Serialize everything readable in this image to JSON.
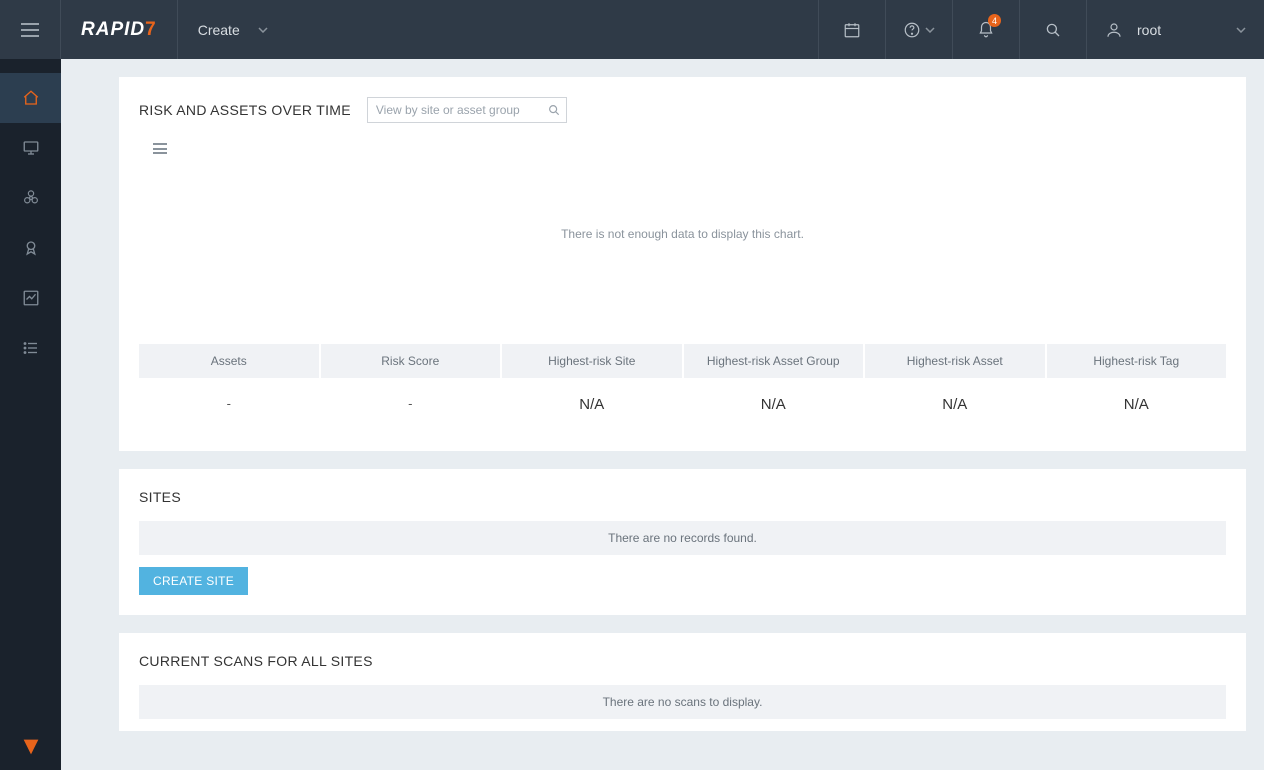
{
  "header": {
    "brand_prefix": "RAPID",
    "brand_suffix": "7",
    "create_label": "Create",
    "user_name": "root",
    "notifications_count": "4"
  },
  "sidebar": {
    "items": [
      {
        "name": "home"
      },
      {
        "name": "assets"
      },
      {
        "name": "vulnerabilities"
      },
      {
        "name": "policies"
      },
      {
        "name": "reports"
      },
      {
        "name": "automation"
      }
    ]
  },
  "risk_panel": {
    "title": "RISK AND ASSETS OVER TIME",
    "filter_placeholder": "View by site or asset group",
    "empty_message": "There is not enough data to display this chart.",
    "summary": [
      {
        "label": "Assets",
        "value": "-",
        "small": true
      },
      {
        "label": "Risk Score",
        "value": "-",
        "small": true
      },
      {
        "label": "Highest-risk Site",
        "value": "N/A",
        "small": false
      },
      {
        "label": "Highest-risk Asset Group",
        "value": "N/A",
        "small": false
      },
      {
        "label": "Highest-risk Asset",
        "value": "N/A",
        "small": false
      },
      {
        "label": "Highest-risk Tag",
        "value": "N/A",
        "small": false
      }
    ]
  },
  "sites_panel": {
    "title": "SITES",
    "empty_message": "There are no records found.",
    "create_button": "CREATE SITE"
  },
  "scans_panel": {
    "title": "CURRENT SCANS FOR ALL SITES",
    "empty_message": "There are no scans to display."
  },
  "colors": {
    "accent": "#e8641b",
    "primary_button": "#52b3e0",
    "header_bg": "#2f3a47",
    "sidebar_bg": "#1a222c"
  }
}
